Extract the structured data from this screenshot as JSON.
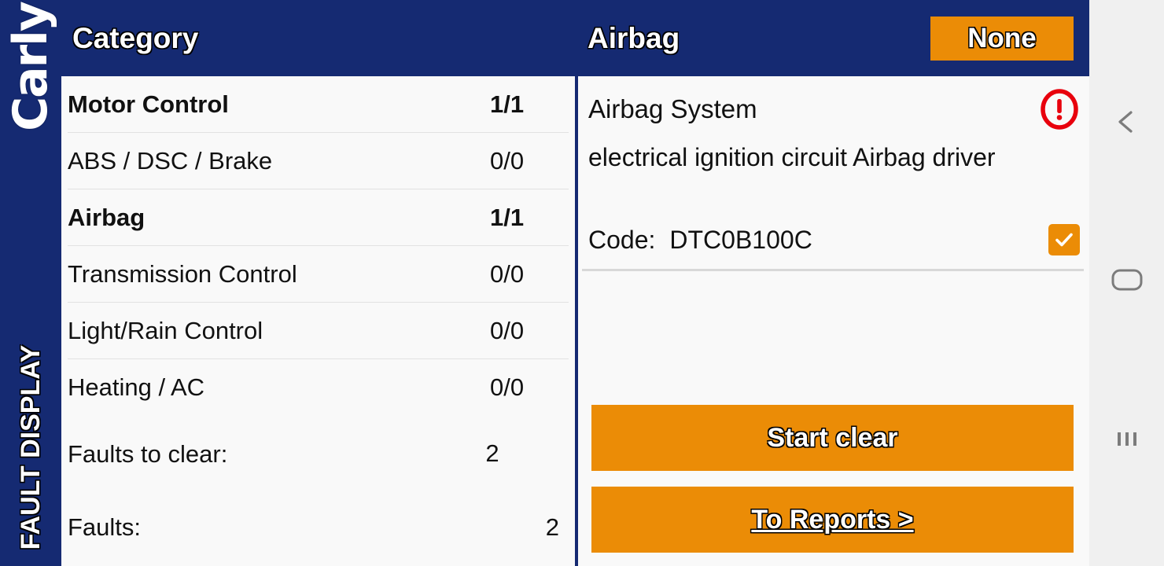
{
  "brand": {
    "logo_text": "Carly",
    "screen_label": "FAULT DISPLAY"
  },
  "colors": {
    "navy": "#152a72",
    "orange": "#eb8c06",
    "alert_red": "#e8000d",
    "panel_bg": "#f9f9f9",
    "navbar_bg": "#f0f0f0",
    "text": "#111111"
  },
  "header": {
    "left_title": "Category",
    "right_title": "Airbag",
    "filter_button_label": "None"
  },
  "category_list": {
    "rows": [
      {
        "name": "Motor Control",
        "count": "1/1",
        "flagged": true
      },
      {
        "name": "ABS / DSC / Brake",
        "count": "0/0",
        "flagged": false
      },
      {
        "name": "Airbag",
        "count": "1/1",
        "flagged": true
      },
      {
        "name": "Transmission Control",
        "count": "0/0",
        "flagged": false
      },
      {
        "name": "Light/Rain Control",
        "count": "0/0",
        "flagged": false
      },
      {
        "name": "Heating / AC",
        "count": "0/0",
        "flagged": false
      }
    ]
  },
  "summary": {
    "faults_to_clear_label": "Faults to clear:",
    "faults_to_clear_value": "2",
    "faults_label": "Faults:",
    "faults_value": "2"
  },
  "detail": {
    "system_title": "Airbag System",
    "warning_icon": "exclamation-circle-icon",
    "description": "electrical ignition circuit Airbag driver",
    "code_label": "Code:",
    "code_value": "DTC0B100C",
    "code_selected": true,
    "start_clear_label": "Start clear",
    "to_reports_label": "To Reports >"
  },
  "navbar": {
    "back_icon": "chevron-left-icon",
    "home_icon": "home-rounded-rect-icon",
    "recents_icon": "recents-bars-icon"
  }
}
